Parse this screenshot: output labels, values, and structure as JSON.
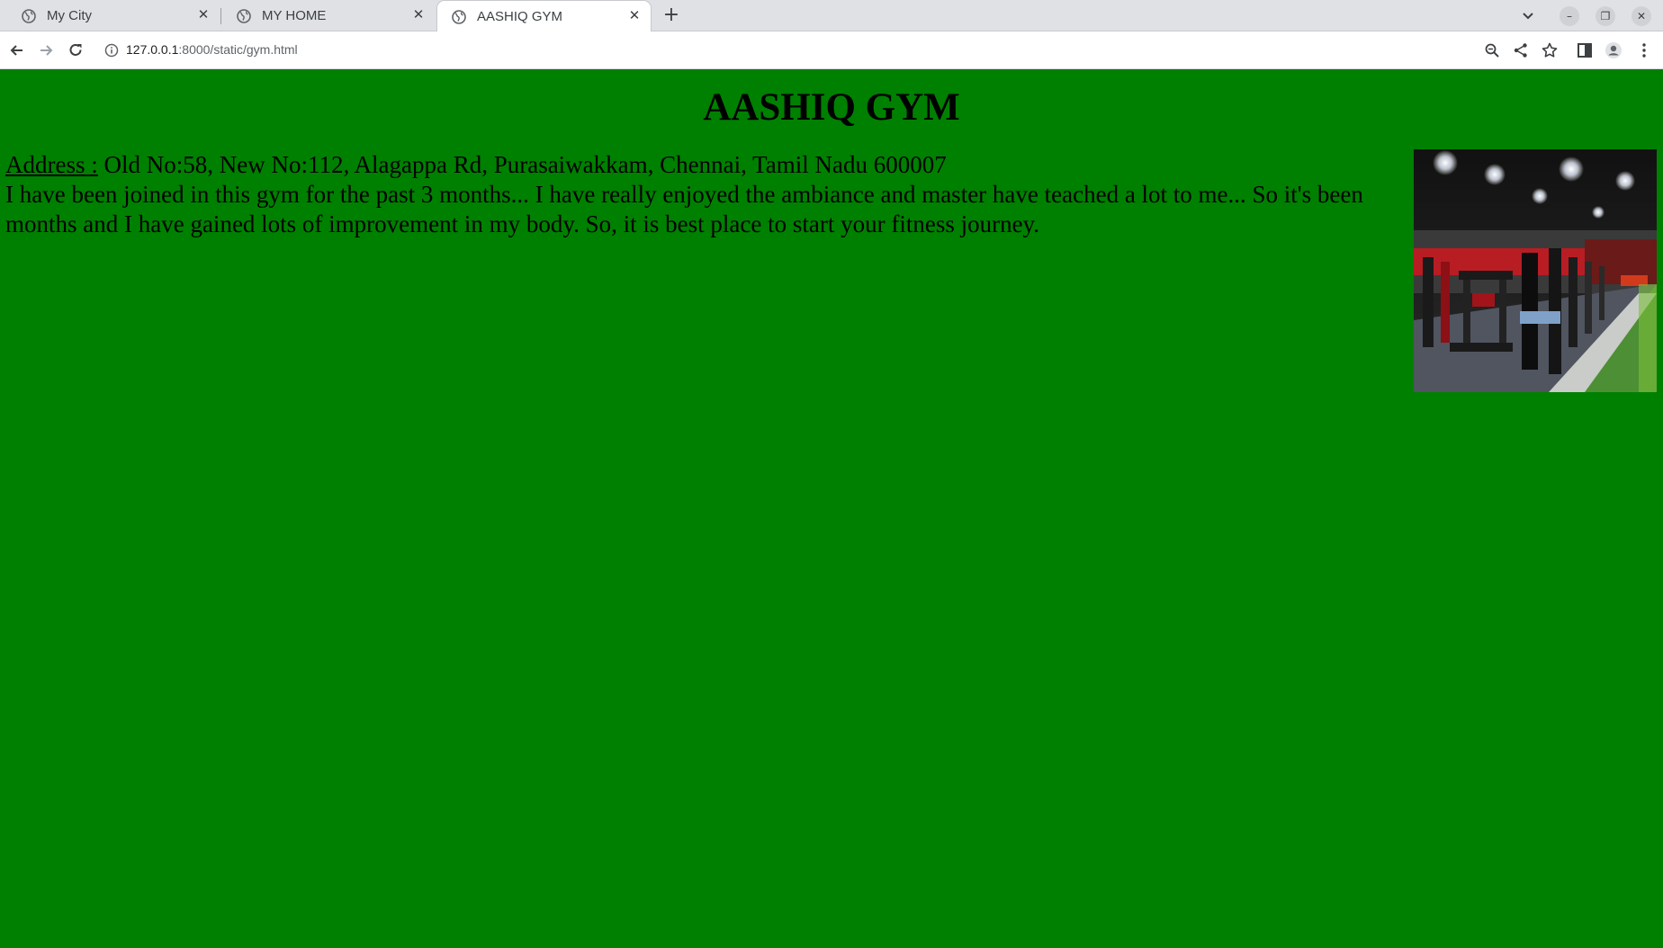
{
  "browser": {
    "tabs": [
      {
        "title": "My City",
        "active": false
      },
      {
        "title": "MY HOME",
        "active": false
      },
      {
        "title": "AASHIQ GYM",
        "active": true
      }
    ],
    "url_host": "127.0.0.1",
    "url_rest": ":8000/static/gym.html"
  },
  "page": {
    "heading": "AASHIQ GYM",
    "address_label": "Address :",
    "address_text": "Old No:58, New No:112, Alagappa Rd, Purasaiwakkam, Chennai, Tamil Nadu 600007",
    "review": "I have been joined in this gym for the past 3 months... I have really enjoyed the ambiance and master have teached a lot to me... So it's been months and I have gained lots of improvement in my body. So, it is best place to start your fitness journey.",
    "background_color": "#008000"
  }
}
